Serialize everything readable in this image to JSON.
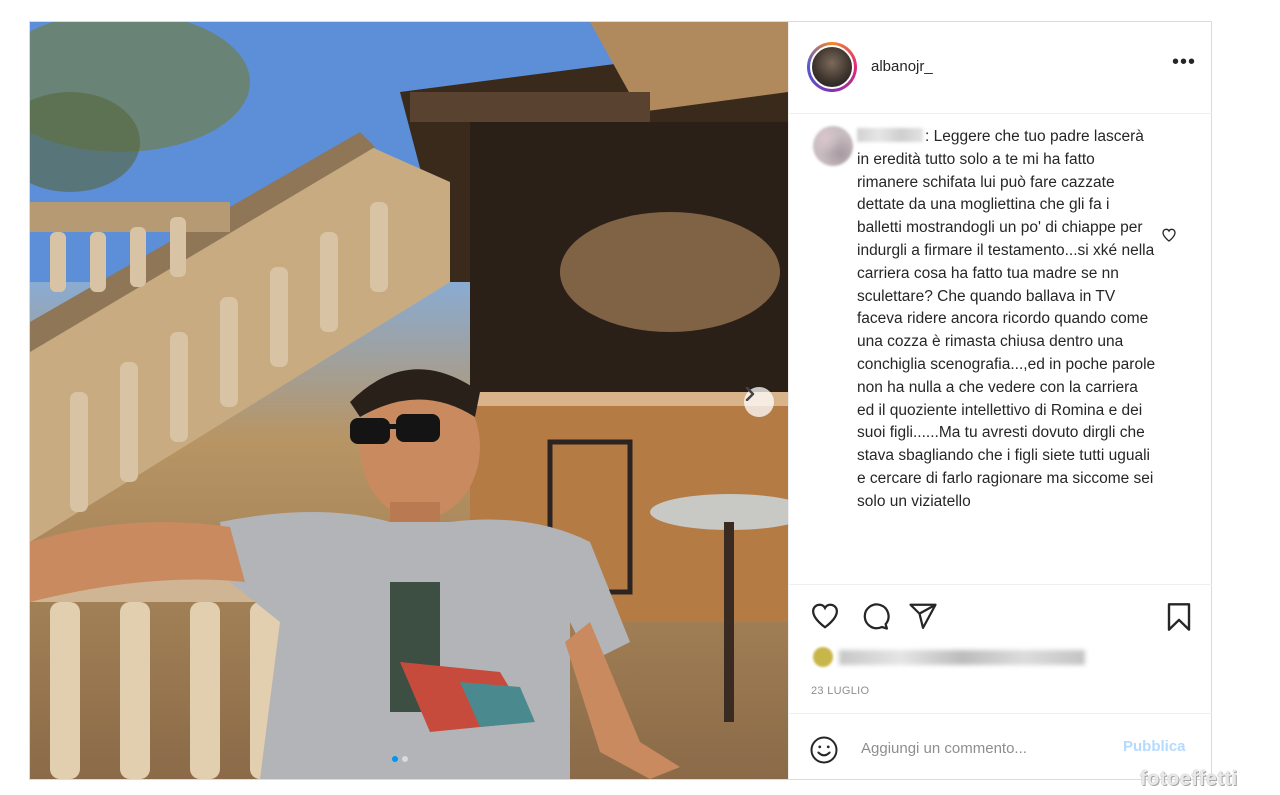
{
  "post": {
    "username": "albanojr_",
    "more_label": "•••",
    "comment": {
      "author": "",
      "text": ": Leggere che tuo padre lascerà in eredità tutto solo a te mi ha fatto rimanere schifata lui può fare cazzate dettate da una mogliettina che gli fa i balletti mostrandogli un po' di chiappe per indurgli a firmare il testamento...si xké nella carriera cosa ha fatto tua madre se nn sculettare? Che quando ballava in TV faceva ridere ancora ricordo quando come una cozza è rimasta chiusa dentro una conchiglia scenografia...,ed in poche parole non ha nulla a che vedere con la carriera ed il quoziente intellettivo di Romina e dei suoi figli......Ma tu avresti dovuto dirgli che stava sbagliando che i figli siete tutti uguali e cercare di farlo ragionare ma siccome sei solo un viziatello"
    },
    "date": "23 LUGLIO",
    "add_comment_placeholder": "Aggiungi un commento...",
    "publish_label": "Pubblica",
    "carousel": {
      "slides": 2,
      "active": 1
    }
  },
  "icons": [
    "like-icon",
    "comment-icon",
    "share-icon",
    "save-icon",
    "emoji-icon",
    "chevron-right-icon",
    "heart-icon",
    "more-icon"
  ],
  "colors": {
    "link_disabled": "#b3dbff",
    "text": "#262626",
    "muted": "#8e8e8e",
    "carousel_active": "#0095f6"
  },
  "watermark": "fotoeffetti"
}
